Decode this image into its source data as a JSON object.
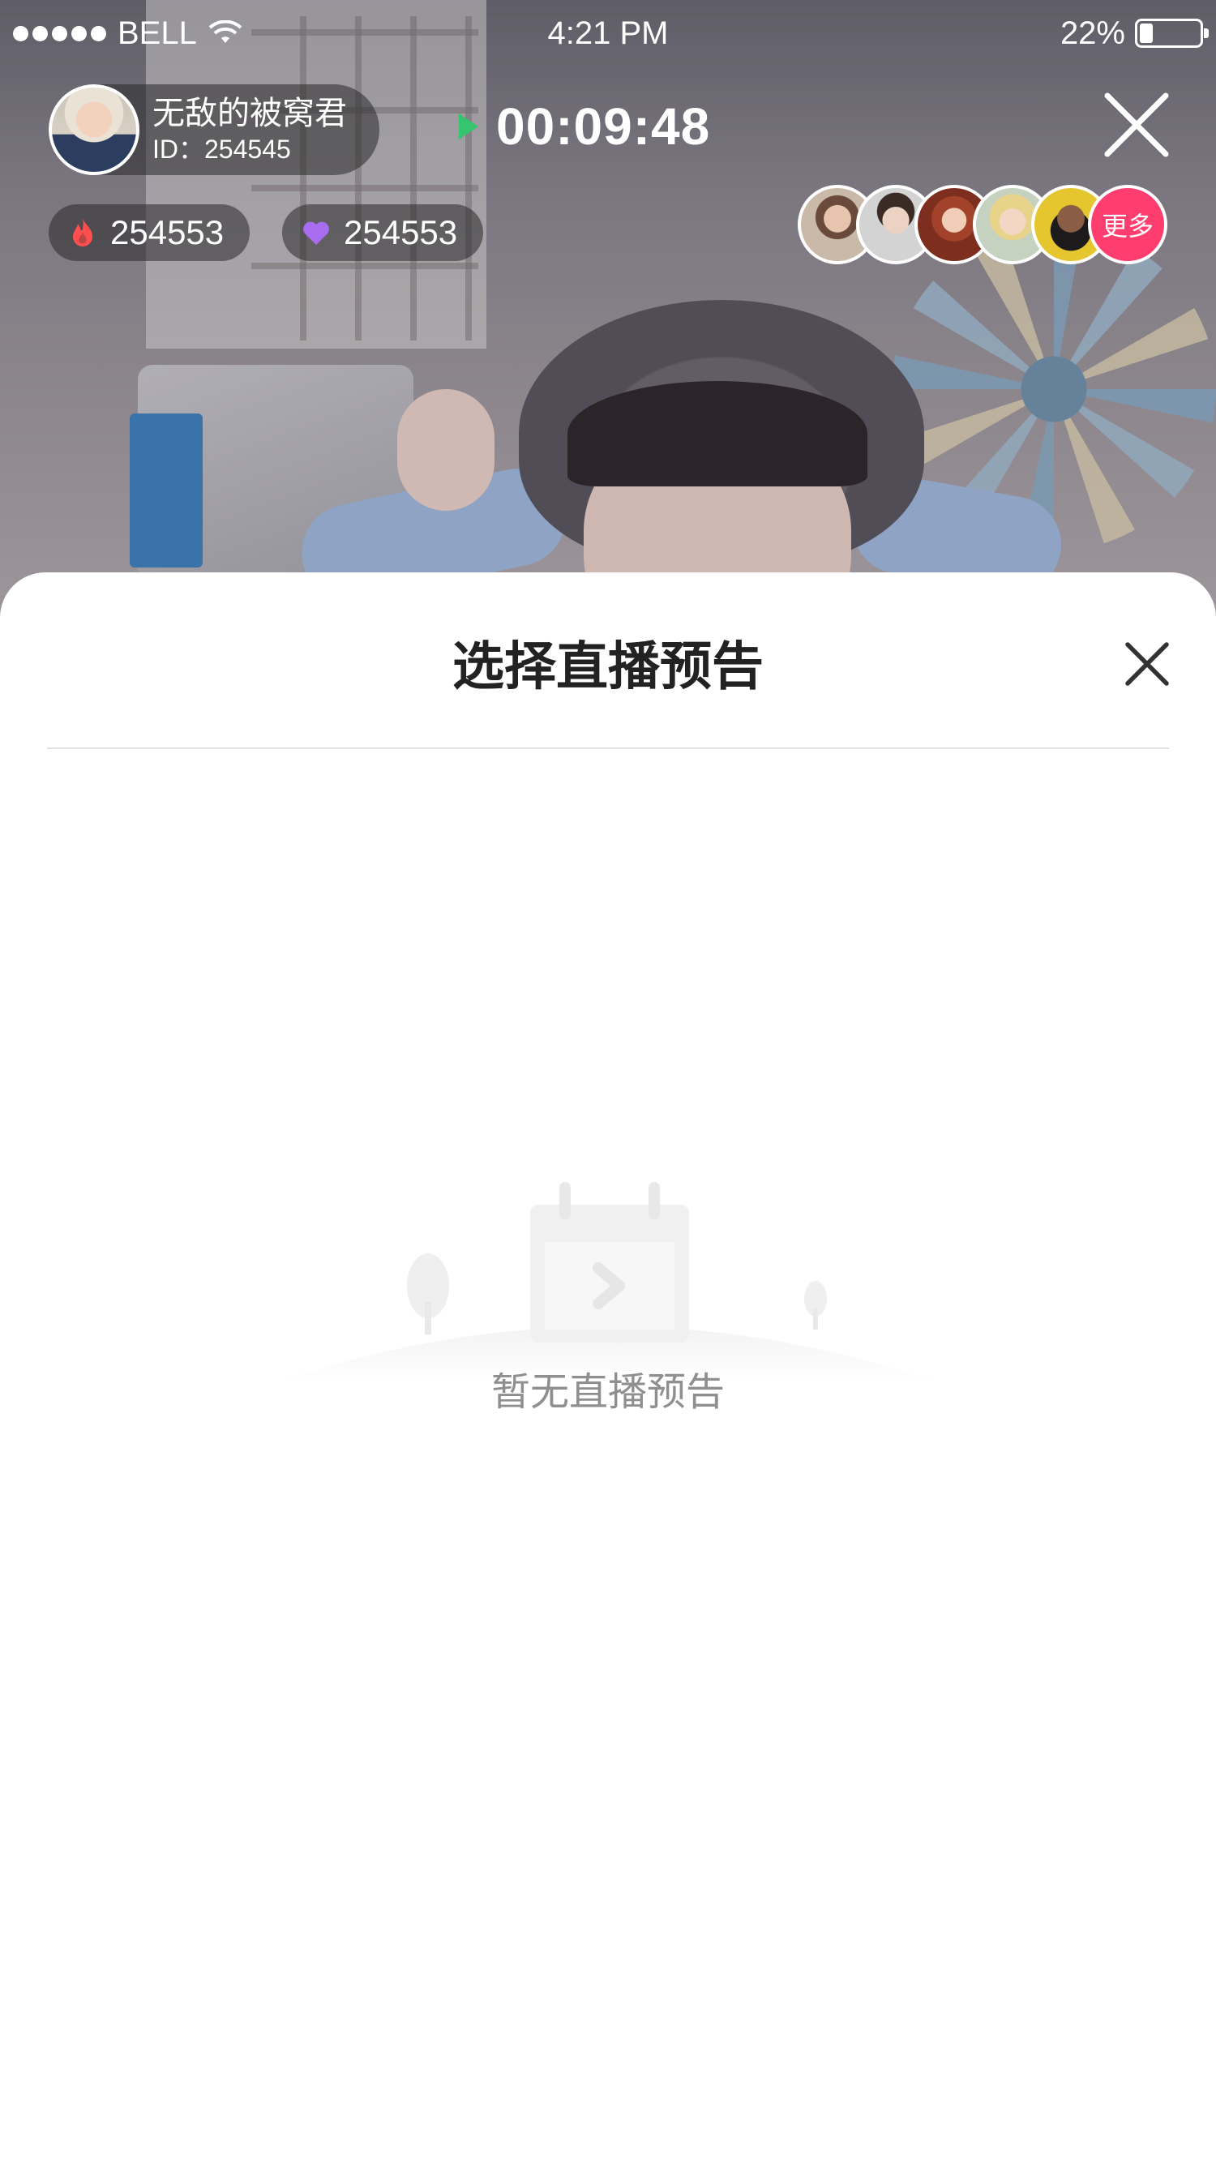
{
  "status_bar": {
    "carrier": "BELL",
    "time": "4:21 PM",
    "battery_percent": "22%",
    "battery_level": 0.22
  },
  "live": {
    "host": {
      "name": "无敌的被窝君",
      "id_label": "ID：254545"
    },
    "timer": "00:09:48",
    "stats": {
      "hot_count": "254553",
      "like_count": "254553"
    },
    "viewers": {
      "more_label": "更多"
    },
    "colors": {
      "play": "#36c46e",
      "hot": "#ff4e4e",
      "like": "#a76cf0",
      "more": "#ff3d6e"
    }
  },
  "sheet": {
    "title": "选择直播预告",
    "empty_text": "暂无直播预告"
  },
  "icons": {
    "wifi": "wifi-icon",
    "play": "play-icon",
    "close": "close-icon",
    "fire": "fire-icon",
    "heart": "heart-icon",
    "calendar": "calendar-icon"
  }
}
